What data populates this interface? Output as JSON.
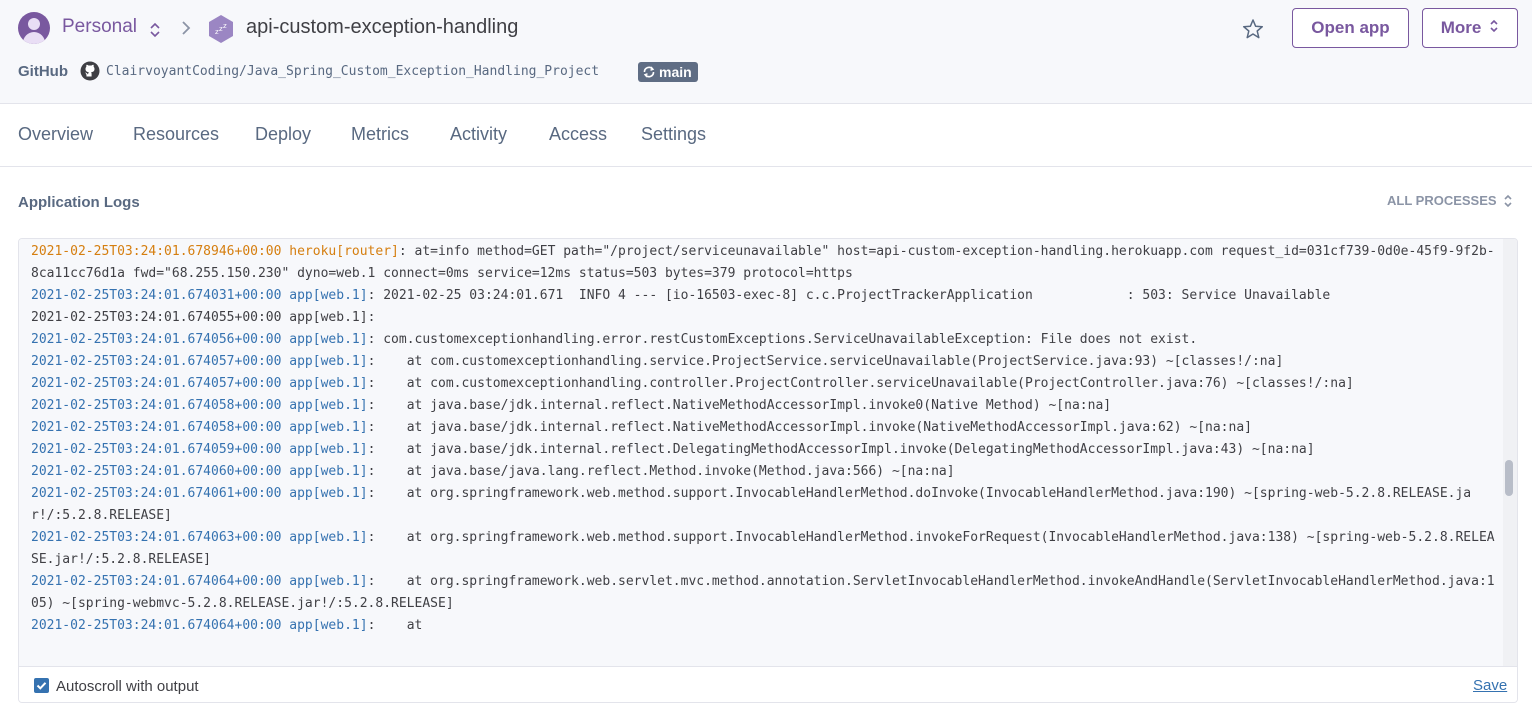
{
  "header": {
    "account": "Personal",
    "app_name": "api-custom-exception-handling",
    "open_app_label": "Open app",
    "more_label": "More",
    "github_label": "GitHub",
    "repo": "ClairvoyantCoding/Java_Spring_Custom_Exception_Handling_Project",
    "branch": "main"
  },
  "tabs": [
    {
      "label": "Overview"
    },
    {
      "label": "Resources"
    },
    {
      "label": "Deploy"
    },
    {
      "label": "Metrics"
    },
    {
      "label": "Activity"
    },
    {
      "label": "Access"
    },
    {
      "label": "Settings"
    }
  ],
  "logs": {
    "title": "Application Logs",
    "process_filter": "ALL PROCESSES",
    "autoscroll_label": "Autoscroll with output",
    "autoscroll_checked": true,
    "save_label": "Save",
    "lines": [
      {
        "ts": "2021-02-25T03:24:01.678946+00:00",
        "source": "heroku[router]",
        "msg": ": at=info method=GET path=\"/project/serviceunavailable\" host=api-custom-exception-handling.herokuapp.com request_id=031cf739-0d0e-45f9-9f2b-8ca11cc76d1a fwd=\"68.255.150.230\" dyno=web.1 connect=0ms service=12ms status=503 bytes=379 protocol=https",
        "color": "orange"
      },
      {
        "ts": "2021-02-25T03:24:01.674031+00:00",
        "source": "app[web.1]",
        "msg": ": 2021-02-25 03:24:01.671  INFO 4 --- [io-16503-exec-8] c.c.ProjectTrackerApplication            : 503: Service Unavailable",
        "color": "blue"
      },
      {
        "ts": "2021-02-25T03:24:01.674055+00:00",
        "source": "app[web.1]",
        "msg": ":",
        "color": "plain"
      },
      {
        "ts": "2021-02-25T03:24:01.674056+00:00",
        "source": "app[web.1]",
        "msg": ": com.customexceptionhandling.error.restCustomExceptions.ServiceUnavailableException: File does not exist.",
        "color": "blue"
      },
      {
        "ts": "2021-02-25T03:24:01.674057+00:00",
        "source": "app[web.1]",
        "msg": ":    at com.customexceptionhandling.service.ProjectService.serviceUnavailable(ProjectService.java:93) ~[classes!/:na]",
        "color": "blue"
      },
      {
        "ts": "2021-02-25T03:24:01.674057+00:00",
        "source": "app[web.1]",
        "msg": ":    at com.customexceptionhandling.controller.ProjectController.serviceUnavailable(ProjectController.java:76) ~[classes!/:na]",
        "color": "blue"
      },
      {
        "ts": "2021-02-25T03:24:01.674058+00:00",
        "source": "app[web.1]",
        "msg": ":    at java.base/jdk.internal.reflect.NativeMethodAccessorImpl.invoke0(Native Method) ~[na:na]",
        "color": "blue"
      },
      {
        "ts": "2021-02-25T03:24:01.674058+00:00",
        "source": "app[web.1]",
        "msg": ":    at java.base/jdk.internal.reflect.NativeMethodAccessorImpl.invoke(NativeMethodAccessorImpl.java:62) ~[na:na]",
        "color": "blue"
      },
      {
        "ts": "2021-02-25T03:24:01.674059+00:00",
        "source": "app[web.1]",
        "msg": ":    at java.base/jdk.internal.reflect.DelegatingMethodAccessorImpl.invoke(DelegatingMethodAccessorImpl.java:43) ~[na:na]",
        "color": "blue"
      },
      {
        "ts": "2021-02-25T03:24:01.674060+00:00",
        "source": "app[web.1]",
        "msg": ":    at java.base/java.lang.reflect.Method.invoke(Method.java:566) ~[na:na]",
        "color": "blue"
      },
      {
        "ts": "2021-02-25T03:24:01.674061+00:00",
        "source": "app[web.1]",
        "msg": ":    at org.springframework.web.method.support.InvocableHandlerMethod.doInvoke(InvocableHandlerMethod.java:190) ~[spring-web-5.2.8.RELEASE.jar!/:5.2.8.RELEASE]",
        "color": "blue"
      },
      {
        "ts": "2021-02-25T03:24:01.674063+00:00",
        "source": "app[web.1]",
        "msg": ":    at org.springframework.web.method.support.InvocableHandlerMethod.invokeForRequest(InvocableHandlerMethod.java:138) ~[spring-web-5.2.8.RELEASE.jar!/:5.2.8.RELEASE]",
        "color": "blue"
      },
      {
        "ts": "2021-02-25T03:24:01.674064+00:00",
        "source": "app[web.1]",
        "msg": ":    at org.springframework.web.servlet.mvc.method.annotation.ServletInvocableHandlerMethod.invokeAndHandle(ServletInvocableHandlerMethod.java:105) ~[spring-webmvc-5.2.8.RELEASE.jar!/:5.2.8.RELEASE]",
        "color": "blue"
      },
      {
        "ts": "2021-02-25T03:24:01.674064+00:00",
        "source": "app[web.1]",
        "msg": ":    at",
        "color": "blue"
      }
    ]
  }
}
